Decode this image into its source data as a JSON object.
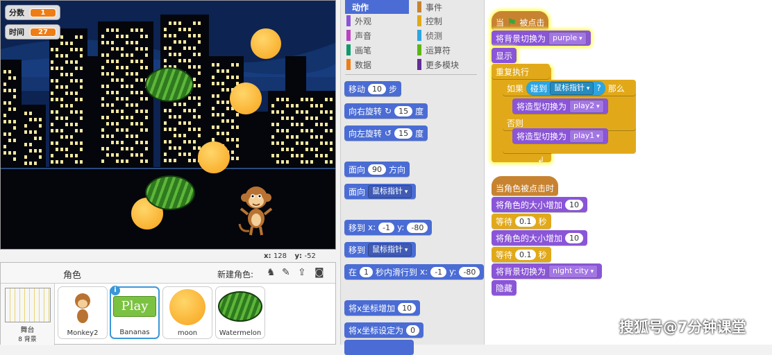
{
  "stage": {
    "score_label": "分数",
    "score_value": "1",
    "time_label": "时间",
    "time_value": "27",
    "x_label": "x:",
    "x_value": "128",
    "y_label": "y:",
    "y_value": "-52"
  },
  "sprite_pane": {
    "title": "角色",
    "new_sprite_label": "新建角色:",
    "stage_label": "舞台",
    "stage_backdrops": "8 背景",
    "sprites": [
      {
        "name": "Monkey2"
      },
      {
        "name": "Bananas",
        "button_text": "Play"
      },
      {
        "name": "moon"
      },
      {
        "name": "Watermelon"
      }
    ]
  },
  "categories": {
    "left": [
      "动作",
      "外观",
      "声音",
      "画笔",
      "数据"
    ],
    "right": [
      "事件",
      "控制",
      "侦测",
      "运算符",
      "更多模块"
    ],
    "left_colors": [
      "#4a6cd4",
      "#8a55d7",
      "#bb42c3",
      "#0e9a6c",
      "#ee7d16"
    ],
    "right_colors": [
      "#c88330",
      "#e1a91a",
      "#2ca5e2",
      "#5cb712",
      "#632d99"
    ]
  },
  "palette": {
    "move": {
      "pre": "移动",
      "n": "10",
      "post": "步"
    },
    "turn_right": {
      "pre": "向右旋转",
      "icon": "↻",
      "n": "15",
      "post": "度"
    },
    "turn_left": {
      "pre": "向左旋转",
      "icon": "↺",
      "n": "15",
      "post": "度"
    },
    "point_dir": {
      "pre": "面向",
      "n": "90",
      "post": "方向"
    },
    "point_towards": {
      "pre": "面向",
      "opt": "鼠标指针"
    },
    "goto_xy": {
      "pre": "移到",
      "x": "x:",
      "xv": "-1",
      "y": "y:",
      "yv": "-80"
    },
    "goto": {
      "pre": "移到",
      "opt": "鼠标指针"
    },
    "glide": {
      "pre": "在",
      "n": "1",
      "mid": "秒内滑行到",
      "x": "x:",
      "xv": "-1",
      "y": "y:",
      "yv": "-80"
    },
    "change_x": {
      "pre": "将x坐标增加",
      "n": "10"
    },
    "set_x": {
      "pre": "将x坐标设定为",
      "n": "0"
    }
  },
  "script1": {
    "hat_pre": "当",
    "hat_post": "被点击",
    "switch_bg": "将背景切换为",
    "bg_value": "purple",
    "show": "显示",
    "forever": "重复执行",
    "if": "如果",
    "touching": "碰到",
    "touching_opt": "鼠标指针",
    "q": "?",
    "then": "那么",
    "switch_costume": "将造型切换为",
    "costume_a": "play2",
    "else": "否则",
    "costume_b": "play1"
  },
  "script2": {
    "hat": "当角色被点击时",
    "change_size": "将角色的大小增加",
    "size1": "10",
    "wait": "等待",
    "wait1": "0.1",
    "sec": "秒",
    "size2": "10",
    "wait2": "0.1",
    "switch_bg": "将背景切换为",
    "bg_value": "night city",
    "hide": "隐藏"
  },
  "watermark": "搜狐号@7分钟课堂"
}
